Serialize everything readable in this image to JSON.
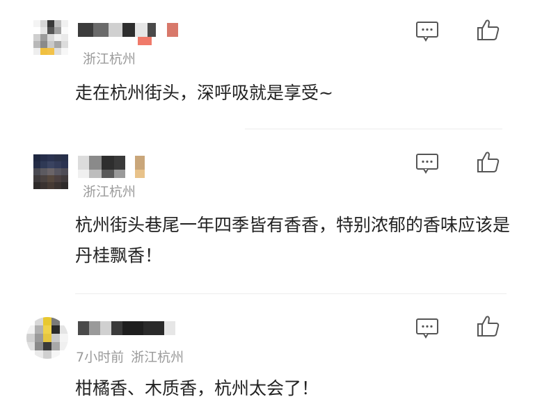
{
  "comments": [
    {
      "time": "",
      "location": "浙江杭州",
      "text": "走在杭州街头，深呼吸就是享受~"
    },
    {
      "time": "",
      "location": "浙江杭州",
      "text": "杭州街头巷尾一年四季皆有香香，特别浓郁的香味应该是丹桂飘香！"
    },
    {
      "time": "7小时前",
      "location": "浙江杭州",
      "text": "柑橘香、木质香，杭州太会了！"
    }
  ],
  "icons": {
    "reply": "comment-bubble-icon",
    "like": "thumbs-up-icon"
  },
  "colors": {
    "body_text": "#222222",
    "meta_text": "#9a9a9a",
    "icon_stroke": "#555555"
  }
}
